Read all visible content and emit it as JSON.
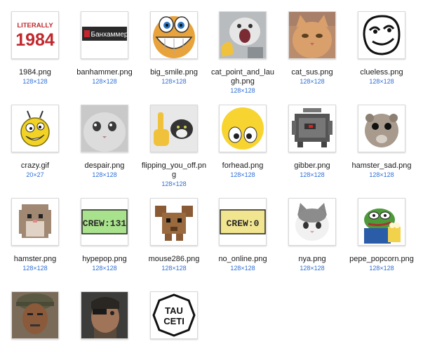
{
  "files": [
    {
      "name": "1984.png",
      "dims": "128×128",
      "icon": "literally-1984-icon",
      "text": [
        "LITERALLY",
        "1984"
      ]
    },
    {
      "name": "banhammer.png",
      "dims": "128×128",
      "icon": "banhammer-icon",
      "text": [
        "Банхаммер"
      ]
    },
    {
      "name": "big_smile.png",
      "dims": "128×128",
      "icon": "big-smile-icon"
    },
    {
      "name": "cat_point_and_laugh.png",
      "dims": "128×128",
      "icon": "cat-point-and-laugh-icon"
    },
    {
      "name": "cat_sus.png",
      "dims": "128×128",
      "icon": "cat-sus-icon"
    },
    {
      "name": "clueless.png",
      "dims": "128×128",
      "icon": "clueless-icon"
    },
    {
      "name": "crazy.gif",
      "dims": "20×27",
      "icon": "crazy-icon"
    },
    {
      "name": "despair.png",
      "dims": "128×128",
      "icon": "despair-cat-icon"
    },
    {
      "name": "flipping_you_off.png",
      "dims": "128×128",
      "icon": "flipping-you-off-icon"
    },
    {
      "name": "forhead.png",
      "dims": "128×128",
      "icon": "forhead-icon"
    },
    {
      "name": "gibber.png",
      "dims": "128×128",
      "icon": "gibber-icon"
    },
    {
      "name": "hamster_sad.png",
      "dims": "128×128",
      "icon": "hamster-sad-icon"
    },
    {
      "name": "hamster.png",
      "dims": "128×128",
      "icon": "hamster-icon"
    },
    {
      "name": "hypepop.png",
      "dims": "128×128",
      "icon": "hypepop-icon",
      "text": [
        "CREW:131"
      ]
    },
    {
      "name": "mouse286.png",
      "dims": "128×128",
      "icon": "mouse286-icon"
    },
    {
      "name": "no_online.png",
      "dims": "128×128",
      "icon": "no-online-icon",
      "text": [
        "CREW:0"
      ]
    },
    {
      "name": "nya.png",
      "dims": "128×128",
      "icon": "nya-icon"
    },
    {
      "name": "pepe_popcorn.png",
      "dims": "128×128",
      "icon": "pepe-popcorn-icon"
    },
    {
      "name": "",
      "dims": "",
      "icon": "soldier-icon"
    },
    {
      "name": "",
      "dims": "",
      "icon": "snake-icon"
    },
    {
      "name": "",
      "dims": "",
      "icon": "tau-ceti-icon",
      "text": [
        "TAU",
        "CETI"
      ]
    }
  ]
}
